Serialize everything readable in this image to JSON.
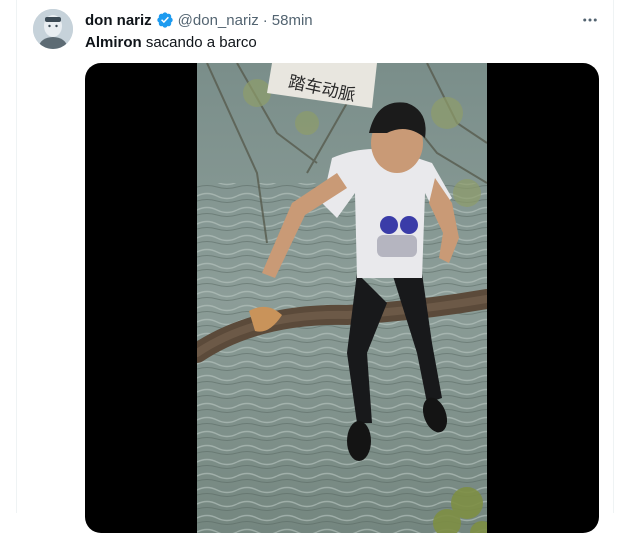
{
  "tweet": {
    "author_name": "don nariz",
    "handle": "@don_nariz",
    "separator": "·",
    "time": "58min",
    "text_bold": "Almiron",
    "text_rest": " sacando a barco",
    "verified_color": "#1d9bf0"
  },
  "icons": {
    "verified": "verified-badge-icon",
    "more": "more-options-icon"
  },
  "media": {
    "type": "video",
    "sign_text": "踏车动脈"
  }
}
